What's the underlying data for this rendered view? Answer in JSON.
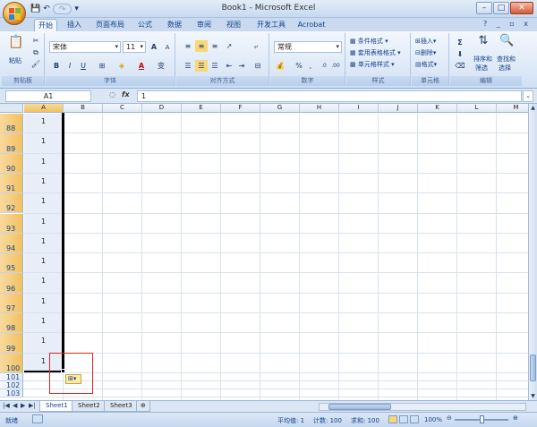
{
  "window": {
    "title": "Book1 - Microsoft Excel",
    "controls": [
      "–",
      "□",
      "✕"
    ]
  },
  "quick_access": {
    "save": "💾",
    "undo": "↶",
    "redo": "↷"
  },
  "ribbon_tabs": [
    {
      "label": "开始",
      "active": true
    },
    {
      "label": "插入"
    },
    {
      "label": "页面布局"
    },
    {
      "label": "公式"
    },
    {
      "label": "数据"
    },
    {
      "label": "审阅"
    },
    {
      "label": "视图"
    },
    {
      "label": "开发工具"
    },
    {
      "label": "Acrobat"
    }
  ],
  "ribbon_right": "? _ ▫ x",
  "ribbon": {
    "clipboard": {
      "label": "剪贴板",
      "paste": "粘贴"
    },
    "font": {
      "label": "字体",
      "name": "宋体",
      "size": "11",
      "bold": "B",
      "italic": "I",
      "underline": "U",
      "grow": "A",
      "shrink": "A",
      "wen": "变"
    },
    "alignment": {
      "label": "对齐方式"
    },
    "number": {
      "label": "数字",
      "format": "常规",
      "percent": "%",
      "comma": ","
    },
    "styles": {
      "label": "样式",
      "conditional": "条件格式",
      "table": "套用表格格式",
      "cell": "单元格样式"
    },
    "cells": {
      "label": "单元格",
      "insert": "插入",
      "delete": "删除",
      "format": "格式"
    },
    "editing": {
      "label": "编辑",
      "sum": "Σ",
      "sort": "排序和",
      "sort2": "筛选",
      "find": "查找和",
      "find2": "选择"
    }
  },
  "formula_bar": {
    "name_box": "A1",
    "fx": "fx",
    "value": "1"
  },
  "columns": [
    "A",
    "B",
    "C",
    "D",
    "E",
    "F",
    "G",
    "H",
    "I",
    "J",
    "K",
    "L",
    "M"
  ],
  "rows": [
    {
      "num": "88",
      "value": "1"
    },
    {
      "num": "89",
      "value": "1"
    },
    {
      "num": "90",
      "value": "1"
    },
    {
      "num": "91",
      "value": "1"
    },
    {
      "num": "92",
      "value": "1"
    },
    {
      "num": "93",
      "value": "1"
    },
    {
      "num": "94",
      "value": "1"
    },
    {
      "num": "95",
      "value": "1"
    },
    {
      "num": "96",
      "value": "1"
    },
    {
      "num": "97",
      "value": "1"
    },
    {
      "num": "98",
      "value": "1"
    },
    {
      "num": "99",
      "value": "1"
    },
    {
      "num": "100",
      "value": "1"
    },
    {
      "num": "101",
      "value": ""
    },
    {
      "num": "102",
      "value": ""
    },
    {
      "num": "103",
      "value": ""
    }
  ],
  "sheets": [
    {
      "label": "Sheet1",
      "active": true
    },
    {
      "label": "Sheet2"
    },
    {
      "label": "Sheet3"
    }
  ],
  "status": {
    "mode": "就绪",
    "average": "平均值: 1",
    "count": "计数: 100",
    "sum": "求和: 100",
    "zoom": "100%"
  }
}
